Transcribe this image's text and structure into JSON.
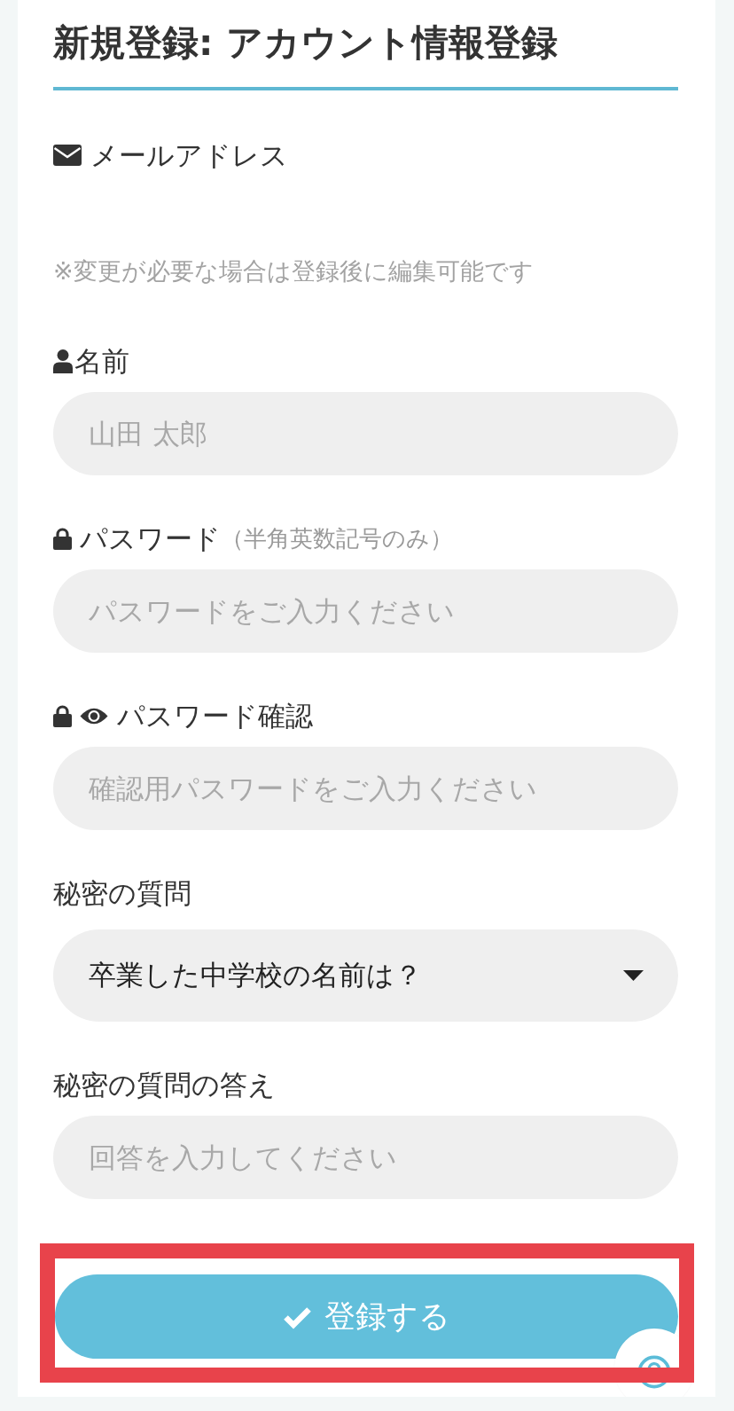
{
  "title": "新規登録: アカウント情報登録",
  "fields": [
    {
      "kind": "email",
      "label": "メールアドレス",
      "note": "※変更が必要な場合は登録後に編集可能です"
    },
    {
      "kind": "name",
      "label": "名前",
      "placeholder": "山田 太郎"
    },
    {
      "kind": "password",
      "label": "パスワード",
      "hint": "（半角英数記号のみ）",
      "placeholder": "パスワードをご入力ください"
    },
    {
      "kind": "confirm",
      "label": "パスワード確認",
      "placeholder": "確認用パスワードをご入力ください"
    },
    {
      "kind": "select",
      "label": "秘密の質問",
      "value": "卒業した中学校の名前は？"
    },
    {
      "kind": "text",
      "label": "秘密の質問の答え",
      "placeholder": "回答を入力してください"
    }
  ],
  "submit_button": {
    "label": "登録する",
    "highlighted": true
  }
}
